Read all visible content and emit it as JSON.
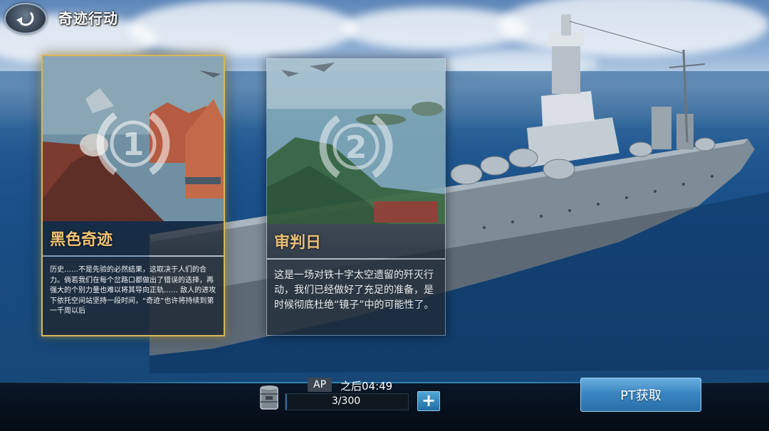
{
  "header": {
    "title": "奇迹行动",
    "back_icon": "back-arrow-icon"
  },
  "cards": [
    {
      "number": "1",
      "title": "黑色奇迹",
      "description": "历史……不是先验的必然结果，这取决于人们的合力。倘若我们在每个岔路口都做出了错误的选择，再强大的个别力量也难以将其导向正轨…… 敌人的进攻下依托空间站坚持一段时间，“奇迹”也许将持续到第一千周以后",
      "selected": true
    },
    {
      "number": "2",
      "title": "审判日",
      "description": "这是一场对铁十字太空遗留的歼灭行动，我们已经做好了充足的准备，是时候彻底杜绝“镜子”中的可能性了。",
      "selected": false
    }
  ],
  "ap": {
    "label": "AP",
    "timer": "之后04:49",
    "count": "3/300",
    "current": 3,
    "max": 300,
    "fuel_icon": "fuel-barrel-icon",
    "plus_label": "+"
  },
  "pt_button": {
    "label": "PT获取"
  },
  "colors": {
    "card_title": "#f1c374",
    "selected_border": "#d9b55a",
    "button_blue": "#3a86c2"
  }
}
